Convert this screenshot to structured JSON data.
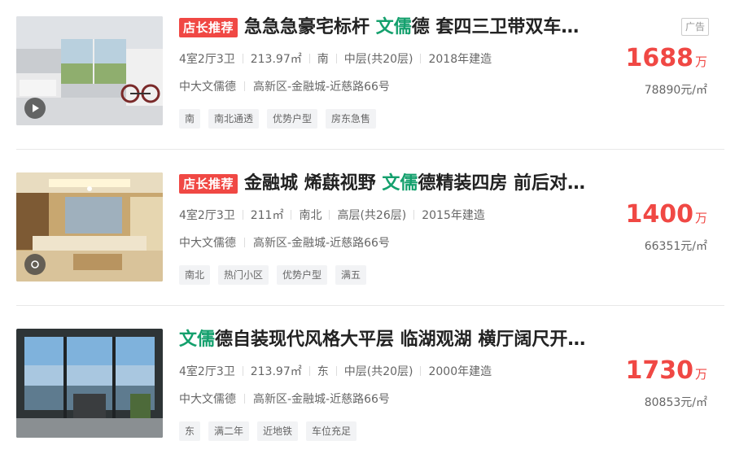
{
  "listings": [
    {
      "badge": "店长推荐",
      "title_pre": "急急急豪宅标杆 ",
      "title_hl": "文儒",
      "title_post": "德 套四三卫带双车…",
      "attrs": [
        "4室2厅3卫",
        "213.97㎡",
        "南",
        "中层(共20层)",
        "2018年建造"
      ],
      "community": "中大文儒德",
      "district": "高新区-金融城-近慈路66号",
      "tags": [
        "南",
        "南北通透",
        "优势户型",
        "房东急售"
      ],
      "price": "1688",
      "price_unit": "万",
      "unit_price": "78890元/㎡",
      "ad": "广告",
      "media_icon": "play-icon"
    },
    {
      "badge": "店长推荐",
      "title_pre": "金融城 烯蕻视野 ",
      "title_hl": "文儒",
      "title_post": "德精装四房 前后对…",
      "attrs": [
        "4室2厅3卫",
        "211㎡",
        "南北",
        "高层(共26层)",
        "2015年建造"
      ],
      "community": "中大文儒德",
      "district": "高新区-金融城-近慈路66号",
      "tags": [
        "南北",
        "热门小区",
        "优势户型",
        "满五"
      ],
      "price": "1400",
      "price_unit": "万",
      "unit_price": "66351元/㎡",
      "ad": "",
      "media_icon": "vr-icon"
    },
    {
      "badge": "",
      "title_pre": "",
      "title_hl": "文儒",
      "title_post": "德自装现代风格大平层 临湖观湖 横厅阔尺开…",
      "attrs": [
        "4室2厅3卫",
        "213.97㎡",
        "东",
        "中层(共20层)",
        "2000年建造"
      ],
      "community": "中大文儒德",
      "district": "高新区-金融城-近慈路66号",
      "tags": [
        "东",
        "满二年",
        "近地铁",
        "车位充足"
      ],
      "price": "1730",
      "price_unit": "万",
      "unit_price": "80853元/㎡",
      "ad": "",
      "media_icon": ""
    }
  ],
  "colors": {
    "accent_red": "#f04844",
    "accent_green": "#14a06d"
  }
}
